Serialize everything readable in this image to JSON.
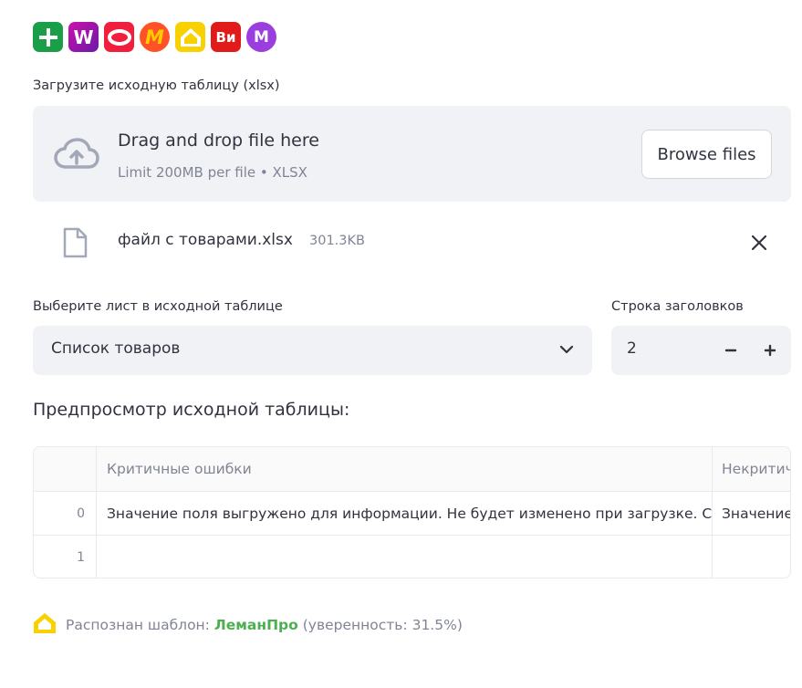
{
  "logos": [
    {
      "name": "plus-logo",
      "bg": "#1a9f48",
      "fg": "#ffffff"
    },
    {
      "name": "wildberries-logo",
      "bg": "#a11bb3",
      "text": "W",
      "fg": "#ffffff"
    },
    {
      "name": "ozon-logo",
      "bg": "#005bff",
      "fg": "#ffffff"
    },
    {
      "name": "yandex-market-logo",
      "bg": "#f43f1e",
      "text": "M",
      "fg": "#ffcc00"
    },
    {
      "name": "lemanpro-logo",
      "bg": "#f7d100",
      "fg": "#ffffff"
    },
    {
      "name": "vseinstrumenti-logo",
      "bg": "#e11a1a",
      "text": "Ви",
      "fg": "#ffffff"
    },
    {
      "name": "megamarket-logo",
      "bg": "#9b3ee0",
      "text": "M",
      "fg": "#ffffff"
    }
  ],
  "uploader": {
    "label": "Загрузите исходную таблицу (xlsx)",
    "drag_text": "Drag and drop file here",
    "limit_text": "Limit 200MB per file • XLSX",
    "browse_label": "Browse files"
  },
  "uploaded_file": {
    "name": "файл с товарами.xlsx",
    "size": "301.3KB"
  },
  "sheet_select": {
    "label": "Выберите лист в исходной таблице",
    "value": "Список товаров"
  },
  "header_row": {
    "label": "Строка заголовков",
    "value": "2",
    "minus": "−",
    "plus": "+"
  },
  "preview": {
    "heading": "Предпросмотр исходной таблицы:",
    "columns": [
      "Критичные ошибки",
      "Некритичные ошибки"
    ],
    "rows": [
      {
        "index": "0",
        "cells": [
          "Значение поля выгружено для информации. Не будет изменено при загрузке. С",
          "Значение"
        ]
      },
      {
        "index": "1",
        "cells": [
          "",
          ""
        ]
      }
    ]
  },
  "status": {
    "prefix": "Распознан шаблон:",
    "template": "ЛеманПро",
    "confidence": "(уверенность: 31.5%)"
  },
  "colors": {
    "accent_green": "#4caf50",
    "surface": "#f0f2f6",
    "muted_text": "#808495"
  }
}
